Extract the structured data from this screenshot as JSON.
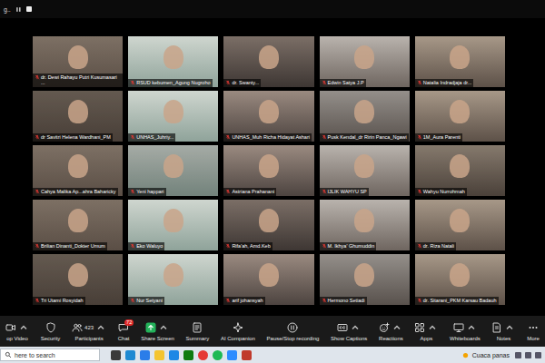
{
  "window": {
    "title": "g.."
  },
  "gallery": {
    "tiles": [
      {
        "name": "dr. Dewi Rahayu Putri Kusumasari ...",
        "muted": true
      },
      {
        "name": "RSUD kebumen_Agung Nugroho",
        "muted": true
      },
      {
        "name": "dr. Swanty...",
        "muted": true
      },
      {
        "name": "Edwin Satya J.P",
        "muted": true
      },
      {
        "name": "Natalia Indradjaja dr...",
        "muted": true
      },
      {
        "name": "dr Savitri Helena Wardhani_PM",
        "muted": true
      },
      {
        "name": "UNHAS_Juhriy...",
        "muted": true
      },
      {
        "name": "UNHAS_Muh Richa Hidayat Ashari",
        "muted": true
      },
      {
        "name": "Pusk Kendal_dr Ririn Panca_Ngawi",
        "muted": true
      },
      {
        "name": "1M_Aura Parenti",
        "muted": true
      },
      {
        "name": "Cahya Malika Ap...ahra Baharicky",
        "muted": true
      },
      {
        "name": "Yeni happari",
        "muted": true
      },
      {
        "name": "Astriana Prahanani",
        "muted": true
      },
      {
        "name": "IJLIK WAHYU SP",
        "muted": true
      },
      {
        "name": "Wahyu Nurrohmah",
        "muted": true
      },
      {
        "name": "Brilian Dinanti_Dokter Umum",
        "muted": true
      },
      {
        "name": "Eko Waluyo",
        "muted": true
      },
      {
        "name": "Rifa'ah, Amd.Keb",
        "muted": true
      },
      {
        "name": "M. Ikhya' Ghumuddin",
        "muted": true
      },
      {
        "name": "dr. Riza Natali",
        "muted": true
      },
      {
        "name": "Tri Utami Rosyidah",
        "muted": true
      },
      {
        "name": "Nur Setyani",
        "muted": true
      },
      {
        "name": "arif johansyah",
        "muted": true
      },
      {
        "name": "Hermono Setiadi",
        "muted": true
      },
      {
        "name": "dr. Sitarani_PKM Karsau Badauh",
        "muted": true
      }
    ]
  },
  "toolbar": {
    "items": [
      {
        "label": "op Video"
      },
      {
        "label": "Security"
      },
      {
        "label": "Participants",
        "count": "423"
      },
      {
        "label": "Chat",
        "badge": "72"
      },
      {
        "label": "Share Screen"
      },
      {
        "label": "Summary"
      },
      {
        "label": "AI Companion"
      },
      {
        "label": "Pause/Stop recording"
      },
      {
        "label": "Show Captions"
      },
      {
        "label": "Reactions"
      },
      {
        "label": "Apps"
      },
      {
        "label": "Whiteboards"
      },
      {
        "label": "Notes"
      },
      {
        "label": "More"
      }
    ]
  },
  "taskbar": {
    "search_placeholder": "here to search",
    "weather": "Cuaca panas"
  }
}
